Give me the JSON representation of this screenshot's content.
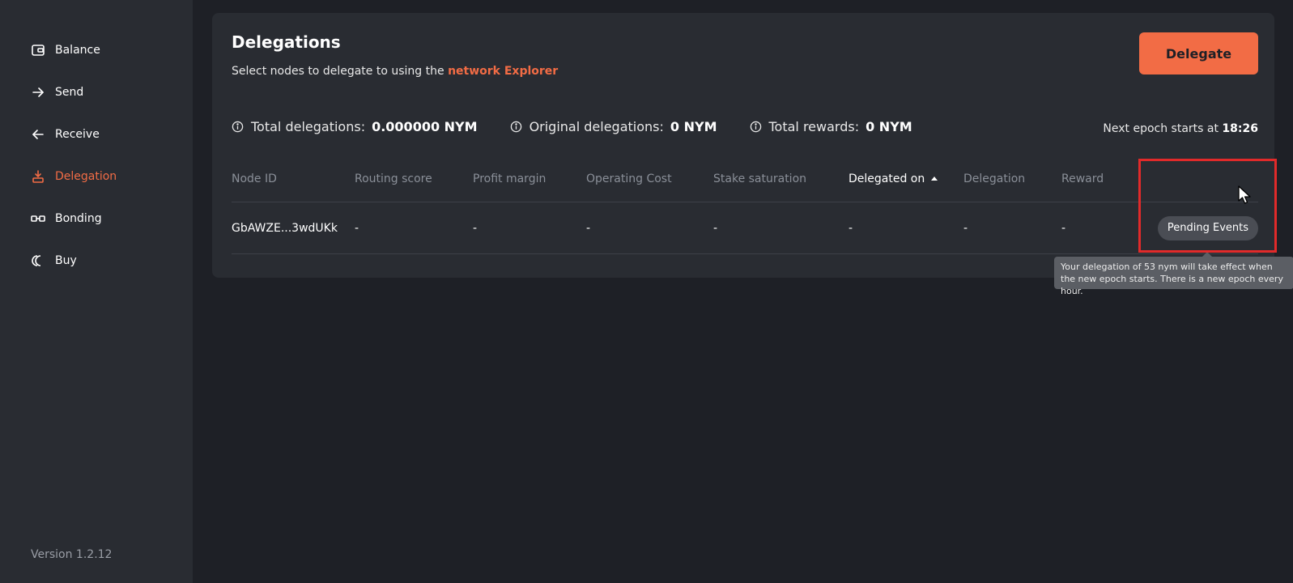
{
  "sidebar": {
    "items": [
      {
        "label": "Balance",
        "icon": "wallet-icon"
      },
      {
        "label": "Send",
        "icon": "arrow-right-icon"
      },
      {
        "label": "Receive",
        "icon": "arrow-left-icon"
      },
      {
        "label": "Delegation",
        "icon": "delegation-icon",
        "active": true
      },
      {
        "label": "Bonding",
        "icon": "bonding-icon"
      },
      {
        "label": "Buy",
        "icon": "buy-icon"
      }
    ],
    "version": "Version 1.2.12"
  },
  "main": {
    "title": "Delegations",
    "subtitle_prefix": "Select nodes to delegate to using the",
    "subtitle_link": "network Explorer",
    "delegate_button": "Delegate",
    "stats": {
      "total_delegations_label": "Total delegations:",
      "total_delegations_value": "0.000000 NYM",
      "original_delegations_label": "Original delegations:",
      "original_delegations_value": "0 NYM",
      "total_rewards_label": "Total rewards:",
      "total_rewards_value": "0 NYM"
    },
    "epoch_prefix": "Next epoch starts at",
    "epoch_time": "18:26",
    "table": {
      "columns": [
        "Node ID",
        "Routing score",
        "Profit margin",
        "Operating Cost",
        "Stake saturation",
        "Delegated on",
        "Delegation",
        "Reward"
      ],
      "sorted_column": "Delegated on",
      "rows": [
        {
          "node_id": "GbAWZE...3wdUKk",
          "routing_score": "-",
          "profit_margin": "-",
          "operating_cost": "-",
          "stake_saturation": "-",
          "delegated_on": "-",
          "delegation": "-",
          "reward": "-",
          "status": "Pending Events"
        }
      ]
    },
    "tooltip": "Your delegation of 53 nym will take effect when the new epoch starts. There is a new epoch every hour."
  },
  "colors": {
    "accent": "#f26c45",
    "background": "#1e2026",
    "panel": "#292c32",
    "highlight": "#e12a2a"
  }
}
